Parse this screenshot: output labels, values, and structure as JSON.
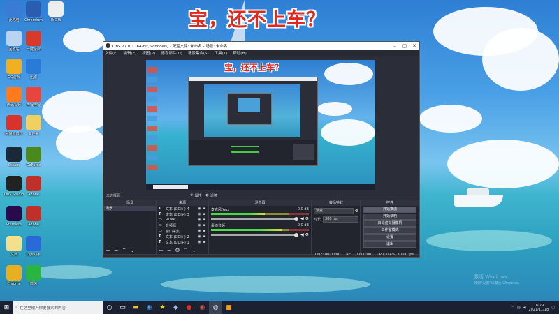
{
  "headline": "宝，还不上车？",
  "desktop_icons": [
    {
      "label": "此电脑",
      "icon": "pc-icon",
      "color": "#3a7bd5"
    },
    {
      "label": "Chromium",
      "icon": "chromium-icon",
      "color": "#2a5db0"
    },
    {
      "label": "新文档",
      "icon": "doc-icon",
      "color": "#eeeeee"
    },
    {
      "label": "回收站",
      "icon": "recycle-bin-icon",
      "color": "#b8d4f0"
    },
    {
      "label": "一键录屏",
      "icon": "record-icon",
      "color": "#d83a2a"
    },
    {
      "label": "QQ游戏",
      "icon": "qq-game-icon",
      "color": "#f0b020"
    },
    {
      "label": "迅雷",
      "icon": "thunder-icon",
      "color": "#2a7ad8"
    },
    {
      "label": "腾讯视频",
      "icon": "video-icon",
      "color": "#ff7a1a"
    },
    {
      "label": "哔哩哔哩",
      "icon": "bili-icon",
      "color": "#e8453c"
    },
    {
      "label": "网易云音乐",
      "icon": "music-icon",
      "color": "#d8322a"
    },
    {
      "label": "文件夹",
      "icon": "folder-icon",
      "color": "#f0d060"
    },
    {
      "label": "Steam",
      "icon": "steam-icon",
      "color": "#1b2838"
    },
    {
      "label": "GeForce",
      "icon": "nvidia-icon",
      "color": "#4a8a1a"
    },
    {
      "label": "OBS Studio",
      "icon": "obs-icon",
      "color": "#222222"
    },
    {
      "label": "Adobe",
      "icon": "adobe-icon",
      "color": "#c0302a"
    },
    {
      "label": "Premiere",
      "icon": "premiere-icon",
      "color": "#2a0a4a"
    },
    {
      "label": "Adobe",
      "icon": "adobe-icon",
      "color": "#c0302a"
    },
    {
      "label": "文档",
      "icon": "file-icon",
      "color": "#f4e08a"
    },
    {
      "label": "同步助手",
      "icon": "sync-icon",
      "color": "#2a6ad8"
    },
    {
      "label": "Chrome",
      "icon": "chrome-icon",
      "color": "#e8b020"
    },
    {
      "label": "微信",
      "icon": "wechat-icon",
      "color": "#2ab540"
    }
  ],
  "obs": {
    "title": "OBS 27.0.1 (64-bit, windows) - 配置文件: 未命名 - 场景: 未命名",
    "menu": [
      "文件(F)",
      "编辑(E)",
      "视图(V)",
      "停靠部件(D)",
      "场景集合(S)",
      "工具(T)",
      "帮助(H)"
    ],
    "preview_headline": "宝，还不上车？",
    "no_source_selected": "未选择源",
    "properties_label": "属性",
    "filters_label": "滤镜",
    "docks": {
      "scenes": {
        "title": "场景",
        "items": [
          "场景"
        ]
      },
      "sources": {
        "title": "来源",
        "items": [
          {
            "type": "T",
            "name": "文本 (GDI+) 4"
          },
          {
            "type": "T",
            "name": "文本 (GDI+) 3"
          },
          {
            "type": "▭",
            "name": "RTMP"
          },
          {
            "type": "▭",
            "name": "音频源"
          },
          {
            "type": "▭",
            "name": "窗口采集"
          },
          {
            "type": "T",
            "name": "文本 (GDI+) 2"
          },
          {
            "type": "T",
            "name": "文本 (GDI+) 1"
          }
        ]
      },
      "mixer": {
        "title": "混音器",
        "channels": [
          {
            "name": "麦克风/Aux",
            "db": "0.0 dB",
            "level": 0.55
          },
          {
            "name": "桌面音频",
            "db": "0.0 dB",
            "level": 0.72
          }
        ]
      },
      "transitions": {
        "title": "转场特效",
        "type": "渐变",
        "duration_label": "时长",
        "duration_value": "300 ms"
      },
      "controls": {
        "title": "控件",
        "buttons": [
          "开始推流",
          "开始录制",
          "启动虚拟摄像机",
          "工作室模式",
          "设置",
          "退出"
        ]
      }
    },
    "status": {
      "live": "LIVE: 00:00:00",
      "rec": "REC: 00:00:00",
      "cpu": "CPU: 0.4%, 30.00 fps"
    }
  },
  "taskbar": {
    "search_placeholder": "在这里输入你要搜索的内容",
    "time": "16:29",
    "date": "2021/11/18"
  },
  "watermark": {
    "line1": "激活 Windows",
    "line2": "转到\"设置\"以激活 Windows。"
  }
}
